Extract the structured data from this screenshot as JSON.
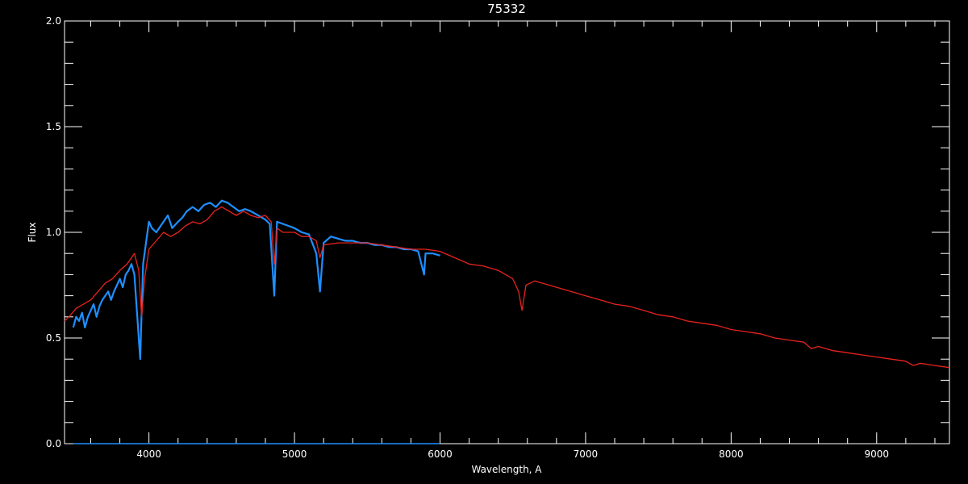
{
  "chart_data": {
    "type": "line",
    "title": "75332",
    "xlabel": "Wavelength, A",
    "ylabel": "Flux",
    "xlim": [
      3420,
      9500
    ],
    "ylim": [
      0.0,
      2.0
    ],
    "x_ticks": [
      4000,
      5000,
      6000,
      7000,
      8000,
      9000
    ],
    "x_tick_labels": [
      "4000",
      "5000",
      "6000",
      "7000",
      "8000",
      "9000"
    ],
    "y_ticks": [
      0.0,
      0.5,
      1.0,
      1.5,
      2.0
    ],
    "y_tick_labels": [
      "0.0",
      "0.5",
      "1.0",
      "1.5",
      "2.0"
    ],
    "grid": false,
    "series": [
      {
        "color": "#1e8fff",
        "style": "observed spectrum",
        "x": [
          3480,
          3500,
          3520,
          3540,
          3560,
          3580,
          3600,
          3620,
          3640,
          3660,
          3680,
          3700,
          3720,
          3740,
          3760,
          3780,
          3800,
          3820,
          3840,
          3860,
          3880,
          3900,
          3920,
          3940,
          3960,
          3980,
          4000,
          4020,
          4050,
          4080,
          4100,
          4130,
          4160,
          4200,
          4230,
          4260,
          4300,
          4340,
          4380,
          4420,
          4460,
          4500,
          4540,
          4580,
          4620,
          4660,
          4700,
          4750,
          4800,
          4830,
          4861,
          4880,
          4920,
          4960,
          5000,
          5050,
          5100,
          5150,
          5175,
          5200,
          5250,
          5300,
          5350,
          5400,
          5450,
          5500,
          5550,
          5600,
          5650,
          5700,
          5750,
          5800,
          5850,
          5890,
          5900,
          5950,
          6000
        ],
        "y": [
          0.55,
          0.6,
          0.58,
          0.62,
          0.55,
          0.6,
          0.63,
          0.66,
          0.6,
          0.65,
          0.68,
          0.7,
          0.72,
          0.68,
          0.72,
          0.75,
          0.78,
          0.74,
          0.8,
          0.82,
          0.85,
          0.8,
          0.6,
          0.4,
          0.85,
          0.95,
          1.05,
          1.02,
          1.0,
          1.03,
          1.05,
          1.08,
          1.02,
          1.05,
          1.07,
          1.1,
          1.12,
          1.1,
          1.13,
          1.14,
          1.12,
          1.15,
          1.14,
          1.12,
          1.1,
          1.11,
          1.1,
          1.08,
          1.06,
          1.04,
          0.7,
          1.05,
          1.04,
          1.03,
          1.02,
          1.0,
          0.99,
          0.9,
          0.72,
          0.95,
          0.98,
          0.97,
          0.96,
          0.96,
          0.95,
          0.95,
          0.94,
          0.94,
          0.93,
          0.93,
          0.92,
          0.92,
          0.91,
          0.8,
          0.9,
          0.9,
          0.89
        ]
      },
      {
        "color": "#e8231e",
        "style": "model spectrum",
        "x": [
          3420,
          3450,
          3500,
          3550,
          3600,
          3650,
          3700,
          3750,
          3800,
          3850,
          3900,
          3930,
          3950,
          3970,
          4000,
          4050,
          4100,
          4150,
          4200,
          4250,
          4300,
          4350,
          4400,
          4450,
          4500,
          4550,
          4600,
          4650,
          4700,
          4750,
          4800,
          4840,
          4861,
          4880,
          4920,
          5000,
          5050,
          5100,
          5150,
          5175,
          5200,
          5300,
          5400,
          5500,
          5600,
          5700,
          5800,
          5900,
          6000,
          6100,
          6200,
          6300,
          6400,
          6500,
          6540,
          6563,
          6590,
          6650,
          6700,
          6800,
          6900,
          7000,
          7100,
          7200,
          7300,
          7400,
          7500,
          7600,
          7700,
          7800,
          7900,
          8000,
          8100,
          8200,
          8300,
          8400,
          8500,
          8550,
          8600,
          8650,
          8700,
          8800,
          8900,
          9000,
          9100,
          9200,
          9250,
          9300,
          9400,
          9500
        ],
        "y": [
          0.58,
          0.6,
          0.64,
          0.66,
          0.68,
          0.72,
          0.76,
          0.78,
          0.82,
          0.85,
          0.9,
          0.82,
          0.6,
          0.78,
          0.92,
          0.96,
          1.0,
          0.98,
          1.0,
          1.03,
          1.05,
          1.04,
          1.06,
          1.1,
          1.12,
          1.1,
          1.08,
          1.1,
          1.08,
          1.07,
          1.08,
          1.05,
          0.85,
          1.02,
          1.0,
          1.0,
          0.98,
          0.98,
          0.96,
          0.88,
          0.94,
          0.95,
          0.95,
          0.95,
          0.94,
          0.93,
          0.92,
          0.92,
          0.91,
          0.88,
          0.85,
          0.84,
          0.82,
          0.78,
          0.72,
          0.63,
          0.75,
          0.77,
          0.76,
          0.74,
          0.72,
          0.7,
          0.68,
          0.66,
          0.65,
          0.63,
          0.61,
          0.6,
          0.58,
          0.57,
          0.56,
          0.54,
          0.53,
          0.52,
          0.5,
          0.49,
          0.48,
          0.45,
          0.46,
          0.45,
          0.44,
          0.43,
          0.42,
          0.41,
          0.4,
          0.39,
          0.37,
          0.38,
          0.37,
          0.36
        ]
      },
      {
        "color": "#1e8fff",
        "style": "zero baseline",
        "x": [
          3480,
          6000
        ],
        "y": [
          0.0,
          0.0
        ]
      }
    ]
  }
}
